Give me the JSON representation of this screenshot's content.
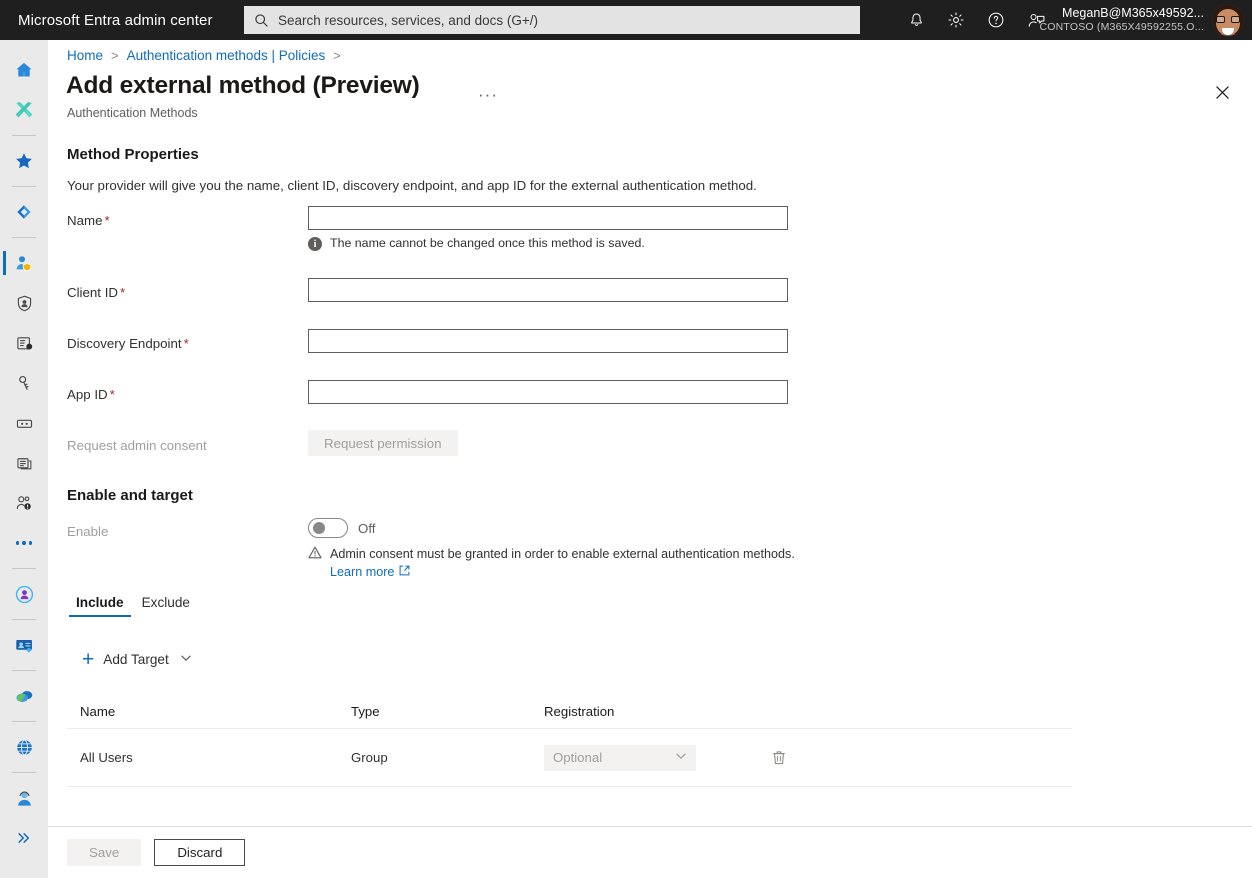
{
  "topbar": {
    "brand": "Microsoft Entra admin center",
    "search": {
      "placeholder": "Search resources, services, and docs (G+/)",
      "value": ""
    },
    "icons": [
      {
        "name": "notifications-icon",
        "label": "Notifications"
      },
      {
        "name": "settings-gear-icon",
        "label": "Settings"
      },
      {
        "name": "help-question-icon",
        "label": "Help"
      },
      {
        "name": "feedback-icon",
        "label": "Feedback"
      }
    ],
    "account": {
      "name": "MeganB@M365x49592...",
      "org": "CONTOSO (M365X49592255.O...",
      "avatar_alt": "User avatar"
    }
  },
  "rail": {
    "items": [
      {
        "name": "home-icon",
        "label": "Home",
        "selected": false
      },
      {
        "name": "diagnose-tools-icon",
        "label": "Diagnose & solve problems",
        "selected": false
      },
      {
        "name": "favorites-star-icon",
        "label": "Favorites",
        "selected": false
      },
      {
        "name": "entra-id-icon",
        "label": "Entra ID",
        "selected": false
      },
      {
        "name": "protection-user-icon",
        "label": "Protection",
        "selected": true
      },
      {
        "name": "identity-governance-icon",
        "label": "Identity Governance",
        "selected": false
      },
      {
        "name": "verified-id-icon",
        "label": "Verified ID",
        "selected": false
      },
      {
        "name": "permissions-key-icon",
        "label": "Permissions Management",
        "selected": false
      },
      {
        "name": "devices-icon",
        "label": "Devices",
        "selected": false
      },
      {
        "name": "reports-icon",
        "label": "Reports",
        "selected": false
      },
      {
        "name": "users-alert-icon",
        "label": "Users",
        "selected": false
      },
      {
        "name": "more-dots-icon",
        "label": "Show more",
        "selected": false
      },
      {
        "name": "identity-badge-icon",
        "label": "Identity",
        "selected": false
      },
      {
        "name": "id-card-icon",
        "label": "ID card",
        "selected": false
      },
      {
        "name": "cloud-shield-icon",
        "label": "Cloud",
        "selected": false
      },
      {
        "name": "globe-icon",
        "label": "Global",
        "selected": false
      },
      {
        "name": "support-person-icon",
        "label": "Support",
        "selected": false
      },
      {
        "name": "expand-chevrons-icon",
        "label": "Expand",
        "selected": false
      }
    ]
  },
  "blade": {
    "breadcrumb": [
      "Home",
      "Authentication methods | Policies"
    ],
    "title": "Add external method (Preview)",
    "title_menu": "···",
    "subtitle": "Authentication Methods",
    "close_label": "Close"
  },
  "method_properties": {
    "heading": "Method Properties",
    "description": "Your provider will give you the name, client ID, discovery endpoint, and app ID for the external authentication method.",
    "fields": [
      {
        "label": "Name",
        "required": true,
        "value": "",
        "placeholder": ""
      },
      {
        "label": "Client ID",
        "required": true,
        "value": "",
        "placeholder": ""
      },
      {
        "label": "Discovery Endpoint",
        "required": true,
        "value": "",
        "placeholder": ""
      },
      {
        "label": "App ID",
        "required": true,
        "value": "",
        "placeholder": ""
      }
    ],
    "name_hint": "The name cannot be changed once this method is saved.",
    "consent_label": "Request admin consent",
    "consent_button": "Request permission"
  },
  "enable_target": {
    "heading": "Enable and target",
    "enable_label": "Enable",
    "toggle_state": "Off",
    "warning": "Admin consent must be granted in order to enable external authentication methods.",
    "learn_more": "Learn more",
    "tabs": [
      {
        "label": "Include",
        "active": true
      },
      {
        "label": "Exclude",
        "active": false
      }
    ],
    "add_target": "Add Target",
    "table": {
      "columns": [
        "Name",
        "Type",
        "Registration"
      ],
      "rows": [
        {
          "name": "All Users",
          "type": "Group",
          "registration": "Optional",
          "registration_disabled": true
        }
      ]
    }
  },
  "footer": {
    "save": "Save",
    "discard": "Discard"
  },
  "colors": {
    "accent": "#0f6cbd",
    "topbar_bg": "#1f1f1f",
    "rail_bg": "#eaeaea",
    "required_asterisk": "#a4262c",
    "disabled_bg": "#f3f2f1",
    "disabled_text": "#a19f9d"
  }
}
